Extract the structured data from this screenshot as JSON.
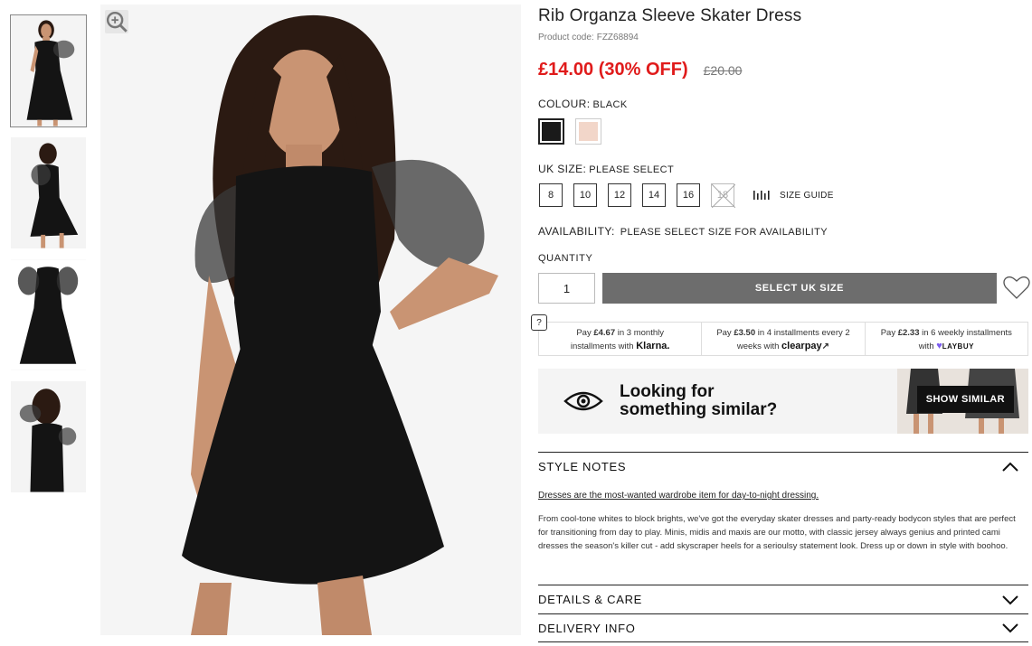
{
  "product": {
    "title": "Rib Organza Sleeve Skater Dress",
    "code_label": "Product code:",
    "code": "FZZ68894",
    "price_now": "£14.00 (30% OFF)",
    "price_was": "£20.00"
  },
  "colour": {
    "label": "COLOUR:",
    "value": "BLACK",
    "swatches": [
      {
        "name": "black",
        "color": "#1a1a1a"
      },
      {
        "name": "nude",
        "color": "#f2d6c9"
      }
    ]
  },
  "size": {
    "label": "UK SIZE:",
    "value": "PLEASE SELECT",
    "options": [
      "8",
      "10",
      "12",
      "14",
      "16",
      "18"
    ],
    "guide_label": "SIZE GUIDE"
  },
  "availability": {
    "label": "AVAILABILITY:",
    "value": "PLEASE SELECT SIZE FOR AVAILABILITY"
  },
  "quantity": {
    "label": "QUANTITY",
    "value": "1"
  },
  "cta": {
    "add_label": "SELECT UK SIZE"
  },
  "payments": {
    "help": "?",
    "klarna": {
      "pre": "Pay ",
      "amount": "£4.67",
      "mid": " in 3 monthly",
      "line2": "installments with ",
      "brand": "Klarna."
    },
    "clearpay": {
      "pre": "Pay ",
      "amount": "£3.50",
      "mid": " in 4 installments every 2",
      "line2": "weeks with ",
      "brand": "clearpay"
    },
    "laybuy": {
      "pre": "Pay ",
      "amount": "£2.33",
      "mid": " in 6 weekly installments",
      "line2": "with ",
      "brand": "LAYBUY"
    }
  },
  "similar": {
    "line1": "Looking for",
    "line2": "something similar?",
    "button": "SHOW SIMILAR"
  },
  "style_notes": {
    "title": "STYLE NOTES",
    "heading": "Dresses are the most-wanted wardrobe item for day-to-night dressing.",
    "body": "From cool-tone whites to block brights, we've got the everyday skater dresses and party-ready bodycon styles that are perfect for transitioning from day to play. Minis, midis and maxis are our motto, with classic jersey always genius and printed cami dresses the season's killer cut - add skyscraper heels for a serioulsy statement look. Dress up or down in style with boohoo."
  },
  "accordions": {
    "details": "DETAILS & CARE",
    "delivery": "DELIVERY INFO"
  },
  "colors": {
    "sale_red": "#e01b1b",
    "button_grey": "#6d6d6d",
    "dress_black": "#141414",
    "skin": "#c99473",
    "hair": "#2b1a12"
  }
}
